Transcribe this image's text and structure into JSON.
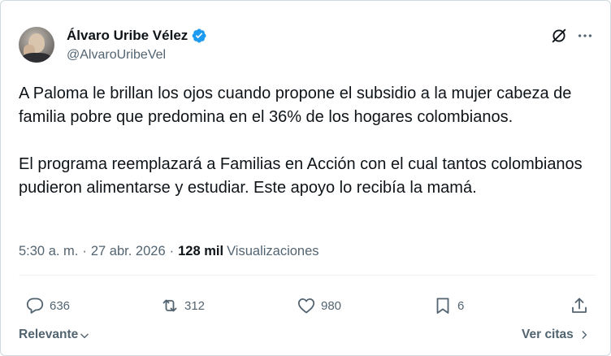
{
  "author": {
    "display_name": "Álvaro Uribe Vélez",
    "handle": "@AlvaroUribeVel",
    "verified": true,
    "avatar_icon": "profile-photo"
  },
  "header_icons": [
    "grok-icon",
    "more-icon"
  ],
  "tweet": {
    "paragraphs": [
      "A Paloma le brillan los ojos cuando propone el subsidio a la mujer cabeza de familia pobre que predomina en el 36% de los hogares colombianos.",
      "El programa reemplazará a Familias en Acción con el cual tantos colombianos pudieron alimentarse y estudiar. Este apoyo lo recibía la mamá."
    ]
  },
  "meta": {
    "time": "5:30 a. m.",
    "separator": "·",
    "date": "27 abr. 2026",
    "views_count": "128 mil",
    "views_label": "Visualizaciones"
  },
  "actions": {
    "replies": "636",
    "reposts": "312",
    "likes": "980",
    "bookmarks": "6"
  },
  "footer": {
    "sort_label": "Relevante",
    "quotes_label": "Ver citas"
  },
  "colors": {
    "text": "#0f1419",
    "secondary": "#536471",
    "verified": "#1d9bf0",
    "border": "#cfd9de"
  }
}
